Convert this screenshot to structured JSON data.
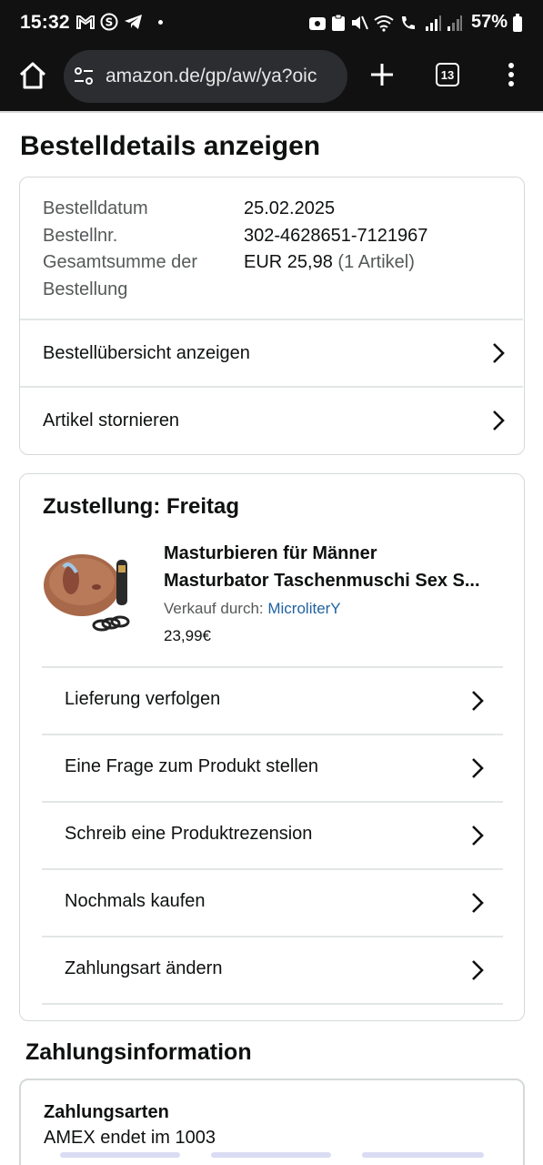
{
  "status_bar": {
    "time": "15:32",
    "battery": "57%",
    "icons": [
      "gmail-icon",
      "skype-icon",
      "telegram-icon",
      "dot-icon",
      "wifi-icon",
      "volume-muted-icon",
      "signal-icon",
      "battery-icon"
    ]
  },
  "browser": {
    "url": "amazon.de/gp/aw/ya?oic",
    "tab_count": "13"
  },
  "page": {
    "title": "Bestelldetails anzeigen"
  },
  "order_summary": {
    "date_label": "Bestelldatum",
    "date_value": "25.02.2025",
    "number_label": "Bestellnr.",
    "number_value": "302-4628651-7121967",
    "total_label_1": "Gesamtsumme der",
    "total_label_2": "Bestellung",
    "total_value": "EUR 25,98",
    "total_items": "(1 Artikel)",
    "actions": [
      {
        "label": "Bestellübersicht anzeigen"
      },
      {
        "label": "Artikel stornieren"
      }
    ]
  },
  "delivery": {
    "title": "Zustellung: Freitag",
    "product_line_1": "Masturbieren für Männer",
    "product_line_2": "Masturbator Taschenmuschi Sex S...",
    "seller_prefix": "Verkauf durch:",
    "seller_name": "MicroliterY",
    "price": "23,99€",
    "actions": [
      {
        "label": "Lieferung verfolgen"
      },
      {
        "label": "Eine Frage zum Produkt stellen"
      },
      {
        "label": "Schreib eine Produktrezension"
      },
      {
        "label": "Nochmals kaufen"
      },
      {
        "label": "Zahlungsart ändern"
      }
    ]
  },
  "payment": {
    "section_title": "Zahlungsinformation",
    "methods_title": "Zahlungsarten",
    "method_text": "AMEX  endet im 1003"
  },
  "colors": {
    "text": "#0f1111",
    "muted": "#565959",
    "link": "#2162a1",
    "border": "#d5d9d9",
    "chrome_bg": "#111111"
  }
}
